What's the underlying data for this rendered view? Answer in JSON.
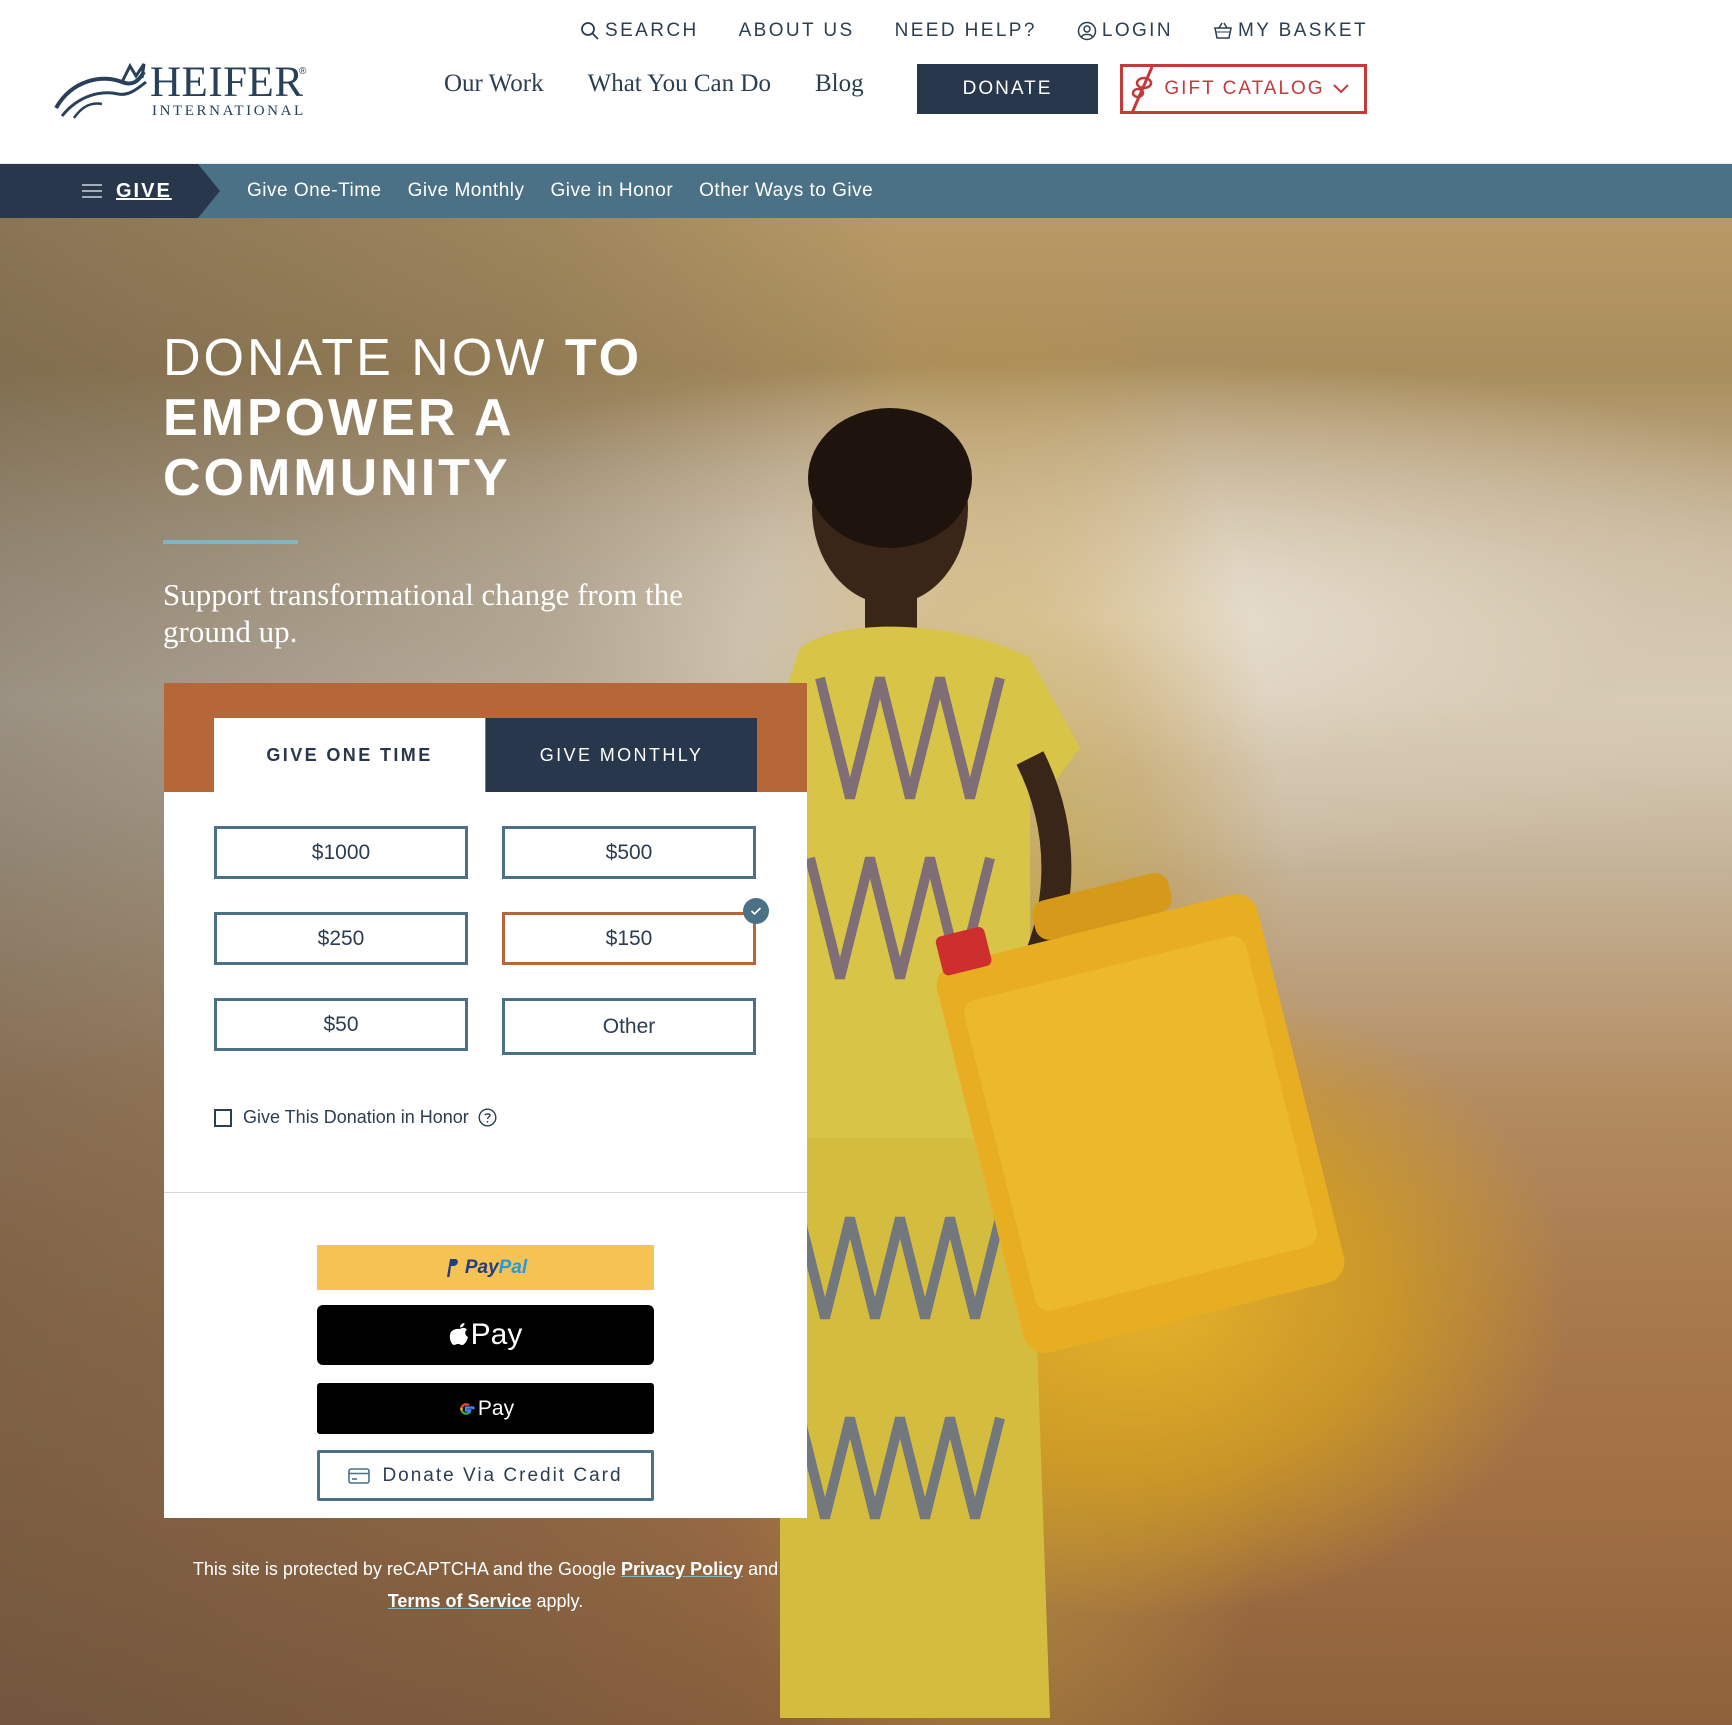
{
  "header": {
    "logo": {
      "name": "HEIFER",
      "registered": "®",
      "subtitle": "INTERNATIONAL"
    },
    "utility_nav": {
      "search": "SEARCH",
      "about": "ABOUT US",
      "help": "NEED HELP?",
      "login": "LOGIN",
      "basket": "MY BASKET"
    },
    "main_nav": {
      "our_work": "Our Work",
      "what_you_can_do": "What You Can Do",
      "blog": "Blog"
    },
    "donate_button": "DONATE",
    "gift_catalog_button": "GIFT CATALOG"
  },
  "give_bar": {
    "label": "GIVE",
    "items": [
      "Give One-Time",
      "Give Monthly",
      "Give in Honor",
      "Other Ways to Give"
    ]
  },
  "hero": {
    "title_light": "DONATE NOW ",
    "title_bold": "TO EMPOWER A COMMUNITY",
    "subtitle": "Support transformational change from the ground up."
  },
  "donation_form": {
    "tabs": {
      "one_time": "GIVE ONE TIME",
      "monthly": "GIVE MONTHLY",
      "active": "one_time"
    },
    "amounts": [
      "$1000",
      "$500",
      "$250",
      "$150",
      "$50",
      "Other"
    ],
    "selected_amount": "$150",
    "honor_label": "Give This Donation in Honor",
    "honor_checked": false,
    "payment": {
      "paypal_a": "Pay",
      "paypal_b": "Pal",
      "apple_pay": "Pay",
      "google_pay": "Pay",
      "credit_card": "Donate Via Credit Card"
    }
  },
  "recaptcha": {
    "text_1": "This site is protected by reCAPTCHA and the Google ",
    "privacy_link": "Privacy Policy",
    "text_2": " and ",
    "terms_link": "Terms of Service",
    "text_3": " apply."
  },
  "colors": {
    "navy": "#28374b",
    "teal": "#4a7186",
    "rust": "#b5673a",
    "catalog_red": "#c33a3a",
    "paypal_yellow": "#f4c354",
    "accent_rule": "#7fb6c4"
  },
  "icons": [
    "search-icon",
    "user-icon",
    "basket-icon",
    "ribbon-icon",
    "chevron-down-icon",
    "menu-icon",
    "check-icon",
    "help-icon",
    "credit-card-icon",
    "apple-icon",
    "google-icon",
    "paypal-icon"
  ]
}
